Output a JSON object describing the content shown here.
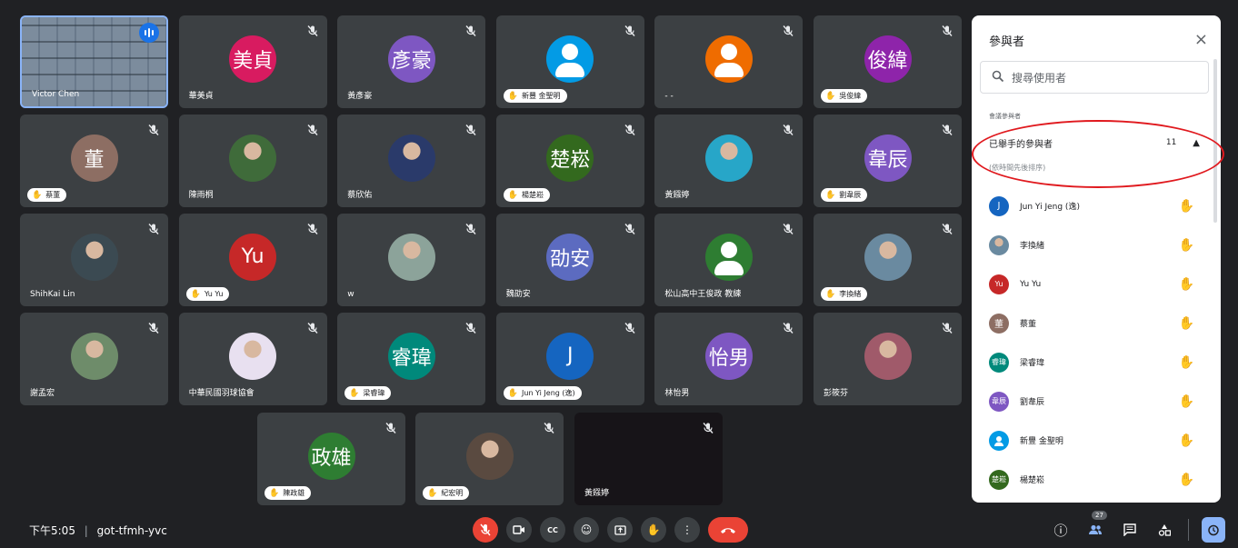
{
  "tiles": [
    {
      "name": "Victor Chen",
      "self": true
    },
    {
      "name": "華美貞",
      "initials": "美貞",
      "color": "#d81b60"
    },
    {
      "name": "黃彥豪",
      "initials": "彥豪",
      "color": "#7e57c2"
    },
    {
      "name": "新豐 金聖明",
      "avatar": "person",
      "color": "#039be5",
      "hand": true
    },
    {
      "name": "- -",
      "avatar": "person",
      "color": "#ef6c00"
    },
    {
      "name": "吳俊緯",
      "initials": "俊緯",
      "color": "#8e24aa",
      "hand": true
    },
    {
      "name": "蔡董",
      "initials": "董",
      "color": "#8d6e63",
      "hand": true
    },
    {
      "name": "陳雨桐",
      "photo": "#3f6b3a"
    },
    {
      "name": "蔡欣佑",
      "photo": "#2a3a6a"
    },
    {
      "name": "楊楚崧",
      "initials": "楚崧",
      "color": "#33691e",
      "hand": true
    },
    {
      "name": "黃鏹婷",
      "photo": "#27a6c8"
    },
    {
      "name": "劉韋辰",
      "initials": "韋辰",
      "color": "#7e57c2",
      "hand": true
    },
    {
      "name": "ShihKai Lin",
      "photo": "#3b4a52"
    },
    {
      "name": "Yu Yu",
      "initials": "Yu",
      "color": "#c62828",
      "hand": true
    },
    {
      "name": "w",
      "photo": "#8ca39a"
    },
    {
      "name": "魏劭安",
      "initials": "劭安",
      "color": "#5c6bc0"
    },
    {
      "name": "松山高中王俊政 教練",
      "avatar": "person",
      "color": "#2e7d32"
    },
    {
      "name": "李換緒",
      "photo": "#6a8aa0",
      "hand": true
    },
    {
      "name": "謝孟宏",
      "photo": "#6e8c6a"
    },
    {
      "name": "中華民國羽球協會",
      "photo": "#e8e0f0"
    },
    {
      "name": "梁睿瑋",
      "initials": "睿瑋",
      "color": "#00897b",
      "hand": true
    },
    {
      "name": "Jun Yi Jeng (逸)",
      "initials": "J",
      "color": "#1565c0",
      "hand": true
    },
    {
      "name": "林怡男",
      "initials": "怡男",
      "color": "#7e57c2"
    },
    {
      "name": "彭筱芬",
      "photo": "#a05a6a"
    },
    {
      "name": "陳政雄",
      "initials": "政雄",
      "color": "#2e7d32",
      "hand": true
    },
    {
      "name": "紀宏明",
      "photo": "#5a4a40",
      "hand": true
    },
    {
      "name": "黃鏹婷",
      "dark": true
    }
  ],
  "panel": {
    "title": "參與者",
    "close": "×",
    "search_placeholder": "搜尋使用者",
    "section": "會議參與者",
    "group_label": "已舉手的參與者",
    "group_count": "11",
    "sub_note": "(依時間先後排序)",
    "people": [
      {
        "name": "Jun Yi Jeng (逸)",
        "initials": "J",
        "color": "#1565c0"
      },
      {
        "name": "李換緒",
        "photo": "#6a8aa0"
      },
      {
        "name": "Yu Yu",
        "initials": "Yu",
        "color": "#c62828"
      },
      {
        "name": "蔡董",
        "initials": "董",
        "color": "#8d6e63"
      },
      {
        "name": "梁睿瑋",
        "initials": "睿瑋",
        "color": "#00897b"
      },
      {
        "name": "劉韋辰",
        "initials": "韋辰",
        "color": "#7e57c2"
      },
      {
        "name": "新豐 金聖明",
        "person": true,
        "color": "#039be5"
      },
      {
        "name": "楊楚崧",
        "initials": "楚崧",
        "color": "#33691e"
      }
    ]
  },
  "bottom": {
    "time": "下午5:05",
    "code": "got-tfmh-yvc",
    "people_count": "27"
  },
  "colors": {
    "background": "#202124",
    "tile": "#3c4043",
    "end_call": "#ea4335",
    "accent": "#8ab4f8",
    "annotation": "#e0191e"
  }
}
